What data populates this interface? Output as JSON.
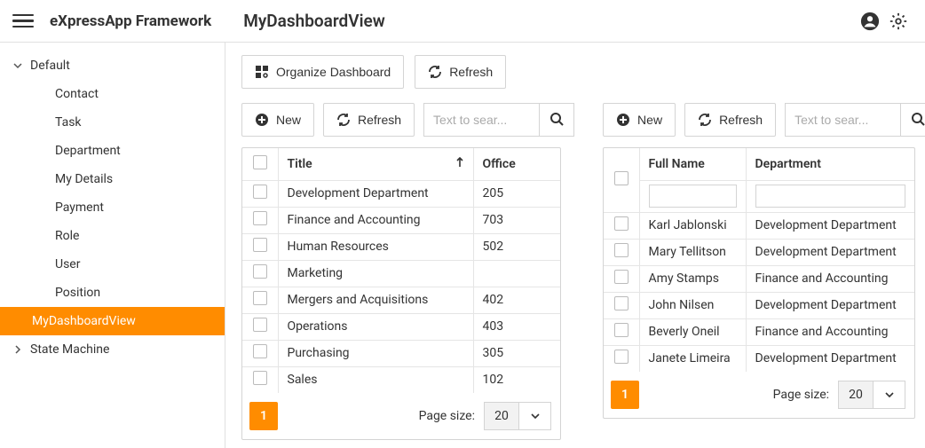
{
  "header": {
    "app_title": "eXpressApp Framework",
    "view_title": "MyDashboardView"
  },
  "nav": {
    "groups": [
      {
        "label": "Default",
        "expanded": true,
        "items": [
          {
            "label": "Contact"
          },
          {
            "label": "Task"
          },
          {
            "label": "Department"
          },
          {
            "label": "My Details"
          },
          {
            "label": "Payment"
          },
          {
            "label": "Role"
          },
          {
            "label": "User"
          },
          {
            "label": "Position"
          },
          {
            "label": "MyDashboardView",
            "selected": true
          }
        ]
      },
      {
        "label": "State Machine",
        "expanded": false,
        "items": []
      }
    ]
  },
  "toolbar": {
    "organize": "Organize Dashboard",
    "refresh": "Refresh"
  },
  "panel_common": {
    "new": "New",
    "refresh": "Refresh",
    "search_placeholder": "Text to sear...",
    "page_size_label": "Page size:",
    "page_size_value": "20",
    "current_page": "1"
  },
  "grid1": {
    "columns": [
      {
        "label": "Title",
        "sort": "asc"
      },
      {
        "label": "Office"
      }
    ],
    "rows": [
      {
        "title": "Development Department",
        "office": "205"
      },
      {
        "title": "Finance and Accounting",
        "office": "703"
      },
      {
        "title": "Human Resources",
        "office": "502"
      },
      {
        "title": "Marketing",
        "office": ""
      },
      {
        "title": "Mergers and Acquisitions",
        "office": "402"
      },
      {
        "title": "Operations",
        "office": "403"
      },
      {
        "title": "Purchasing",
        "office": "305"
      },
      {
        "title": "Sales",
        "office": "102"
      }
    ]
  },
  "grid2": {
    "columns": [
      {
        "label": "Full Name"
      },
      {
        "label": "Department"
      }
    ],
    "rows": [
      {
        "name": "Karl Jablonski",
        "dept": "Development Department"
      },
      {
        "name": "Mary Tellitson",
        "dept": "Development Department"
      },
      {
        "name": "Amy Stamps",
        "dept": "Finance and Accounting"
      },
      {
        "name": "John Nilsen",
        "dept": "Development Department"
      },
      {
        "name": "Beverly Oneil",
        "dept": "Finance and Accounting"
      },
      {
        "name": "Janete Limeira",
        "dept": "Development Department"
      }
    ]
  }
}
